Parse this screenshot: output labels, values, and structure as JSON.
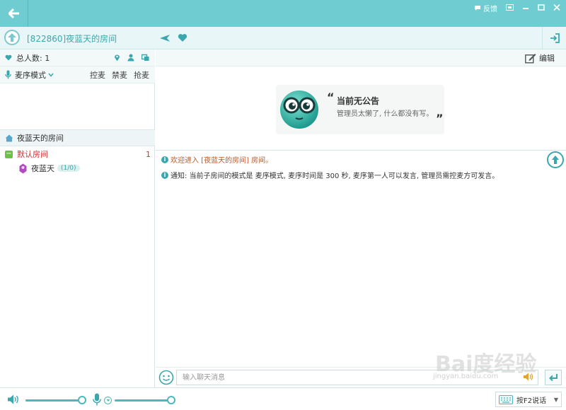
{
  "titlebar": {
    "feedback_label": "反馈"
  },
  "room": {
    "id_title": "[822860]夜蓝天的房间"
  },
  "left_panel": {
    "total_label": "总人数: 1",
    "mode_label": "麦序模式",
    "mode_actions": [
      "控麦",
      "禁麦",
      "抢麦"
    ],
    "room_header": "夜蓝天的房间",
    "default_room": {
      "name": "默认房间",
      "count": "1"
    },
    "user": {
      "name": "夜蓝天",
      "badge": "(1/0)"
    }
  },
  "announcement": {
    "edit_label": "编辑",
    "title": "当前无公告",
    "subtitle": "管理员太懒了, 什么都没有写。"
  },
  "messages": [
    {
      "text": "欢迎进入 [夜蓝天的房间] 房间。"
    },
    {
      "text": "通知: 当前子房间的模式是 麦序模式, 麦序时间是 300 秒, 麦序第一人可以发言, 管理员需控麦方可发言。"
    }
  ],
  "input": {
    "placeholder": "输入聊天消息"
  },
  "bottom": {
    "volume_level": 1.0,
    "mic_level": 1.0,
    "ptt_label": "按F2说话"
  },
  "watermark": {
    "text": "Bai度经验",
    "sub": "jingyan.baidu.com"
  },
  "colors": {
    "accent": "#6fcdd1",
    "accent_dark": "#3aa7ae",
    "welcome": "#b8592a"
  }
}
